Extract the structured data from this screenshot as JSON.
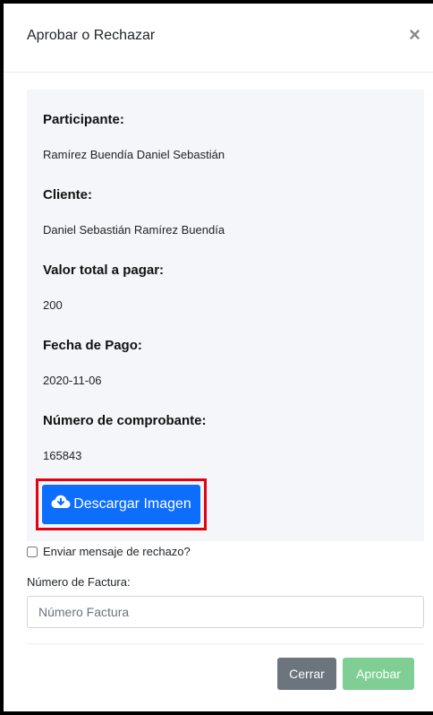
{
  "modal": {
    "title": "Aprobar o Rechazar",
    "close_symbol": "×"
  },
  "details": {
    "participante_label": "Participante:",
    "participante_value": "Ramírez Buendía Daniel Sebastián",
    "cliente_label": "Cliente:",
    "cliente_value": "Daniel Sebastián Ramírez Buendía",
    "valor_label": "Valor total a pagar:",
    "valor_value": "200",
    "fecha_label": "Fecha de Pago:",
    "fecha_value": "2020-11-06",
    "comprobante_label": "Número de comprobante:",
    "comprobante_value": "165843"
  },
  "download": {
    "label": "Descargar Imagen",
    "icon": "cloud-download-icon",
    "color": "#0d6efd",
    "highlight_color": "#e3000f"
  },
  "rechazo": {
    "label": "Enviar mensaje de rechazo?",
    "checked": false
  },
  "factura": {
    "label": "Número de Factura:",
    "placeholder": "Número Factura",
    "value": ""
  },
  "footer": {
    "cerrar_label": "Cerrar",
    "aprobar_label": "Aprobar"
  },
  "colors": {
    "cerrar": "#6c757d",
    "aprobar": "#7fcf95",
    "panel_bg": "#f4f6f9"
  }
}
